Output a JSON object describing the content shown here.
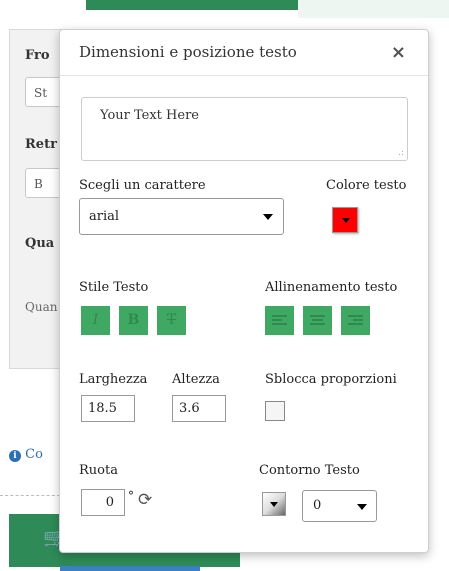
{
  "background": {
    "labels": [
      "Fro",
      "Retr",
      "Qua"
    ],
    "fields": [
      "St",
      "B"
    ],
    "small_text": "Quan",
    "info_text": "Co"
  },
  "dialog": {
    "title": "Dimensioni e posizione testo",
    "close_symbol": "×",
    "text_value": "Your Text Here",
    "font": {
      "label": "Scegli un carattere",
      "selected": "arial"
    },
    "text_color": {
      "label": "Colore testo",
      "value": "#ff0000"
    },
    "text_style": {
      "label": "Stile Testo",
      "buttons": [
        "I",
        "B",
        "T"
      ]
    },
    "alignment": {
      "label": "Allinenamento testo",
      "buttons": [
        "left",
        "center",
        "right"
      ]
    },
    "width": {
      "label": "Larghezza",
      "value": "18.5"
    },
    "height": {
      "label": "Altezza",
      "value": "3.6"
    },
    "unlock_ratio": {
      "label": "Sblocca proporzioni",
      "checked": false
    },
    "rotation": {
      "label": "Ruota",
      "value": "0",
      "unit": "°"
    },
    "outline": {
      "label": "Contorno Testo",
      "selected": "0"
    }
  },
  "colors": {
    "accent_green": "#2e8b57",
    "style_button": "#3fa862",
    "text_color": "#ff0000"
  }
}
